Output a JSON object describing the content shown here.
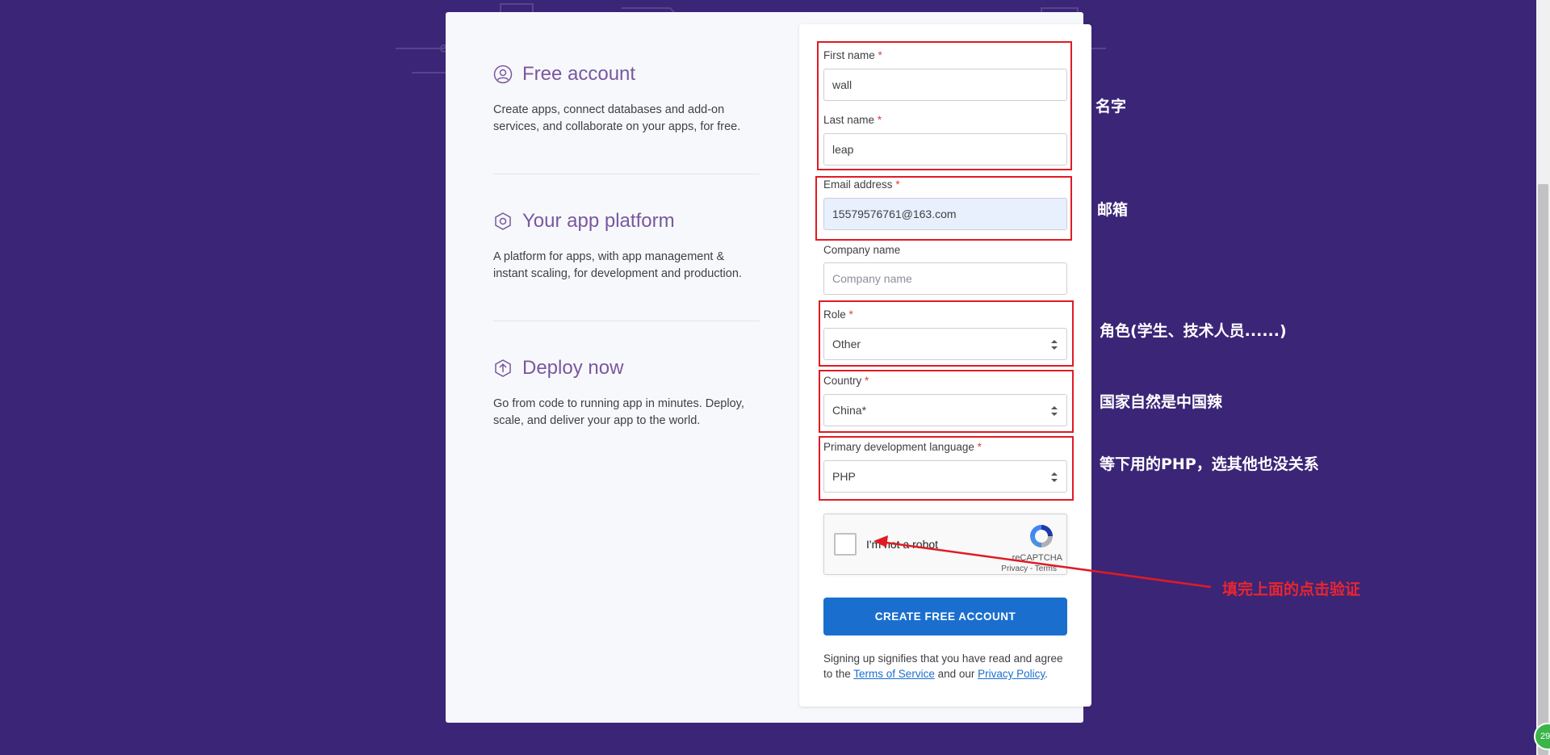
{
  "features": [
    {
      "title": "Free account",
      "desc_line1": "Create apps, connect databases and add-on",
      "desc_line2": "services, and collaborate on your apps, for free.",
      "icon": "user-circle-icon"
    },
    {
      "title": "Your app platform",
      "desc_line1": "A platform for apps, with app management &",
      "desc_line2": "instant scaling, for development and production.",
      "icon": "hexagon-icon"
    },
    {
      "title": "Deploy now",
      "desc_line1": "Go from code to running app in minutes. Deploy,",
      "desc_line2": "scale, and deliver your app to the world.",
      "icon": "upload-icon"
    }
  ],
  "form": {
    "first_name": {
      "label": "First name",
      "required": "*",
      "value": "wall"
    },
    "last_name": {
      "label": "Last name",
      "required": "*",
      "value": "leap"
    },
    "email": {
      "label": "Email address",
      "required": "*",
      "value": "15579576761@163.com"
    },
    "company": {
      "label": "Company name",
      "placeholder": "Company name"
    },
    "role": {
      "label": "Role",
      "required": "*",
      "value": "Other"
    },
    "country": {
      "label": "Country",
      "required": "*",
      "value": "China*"
    },
    "language": {
      "label": "Primary development language",
      "required": "*",
      "value": "PHP"
    },
    "captcha": {
      "label": "I'm not a robot",
      "brand": "reCAPTCHA",
      "links": "Privacy - Terms"
    },
    "submit_label": "CREATE FREE ACCOUNT",
    "legal": {
      "prefix": "Signing up signifies that you have read and agree to the ",
      "terms": "Terms of Service",
      "middle": " and our ",
      "privacy": "Privacy Policy",
      "suffix": "."
    }
  },
  "annotations": {
    "name": "名字",
    "email": "邮箱",
    "role": "角色(学生、技术人员......)",
    "country": "国家自然是中国辣",
    "language": "等下用的PHP，选其他也没关系",
    "captcha": "填完上面的点击验证"
  },
  "badge_text": "29",
  "colors": {
    "background": "#3b2577",
    "accent": "#79589f",
    "button": "#1a6fce",
    "annotation_box": "#e01b24",
    "annotation_red_text": "#e8262f"
  }
}
